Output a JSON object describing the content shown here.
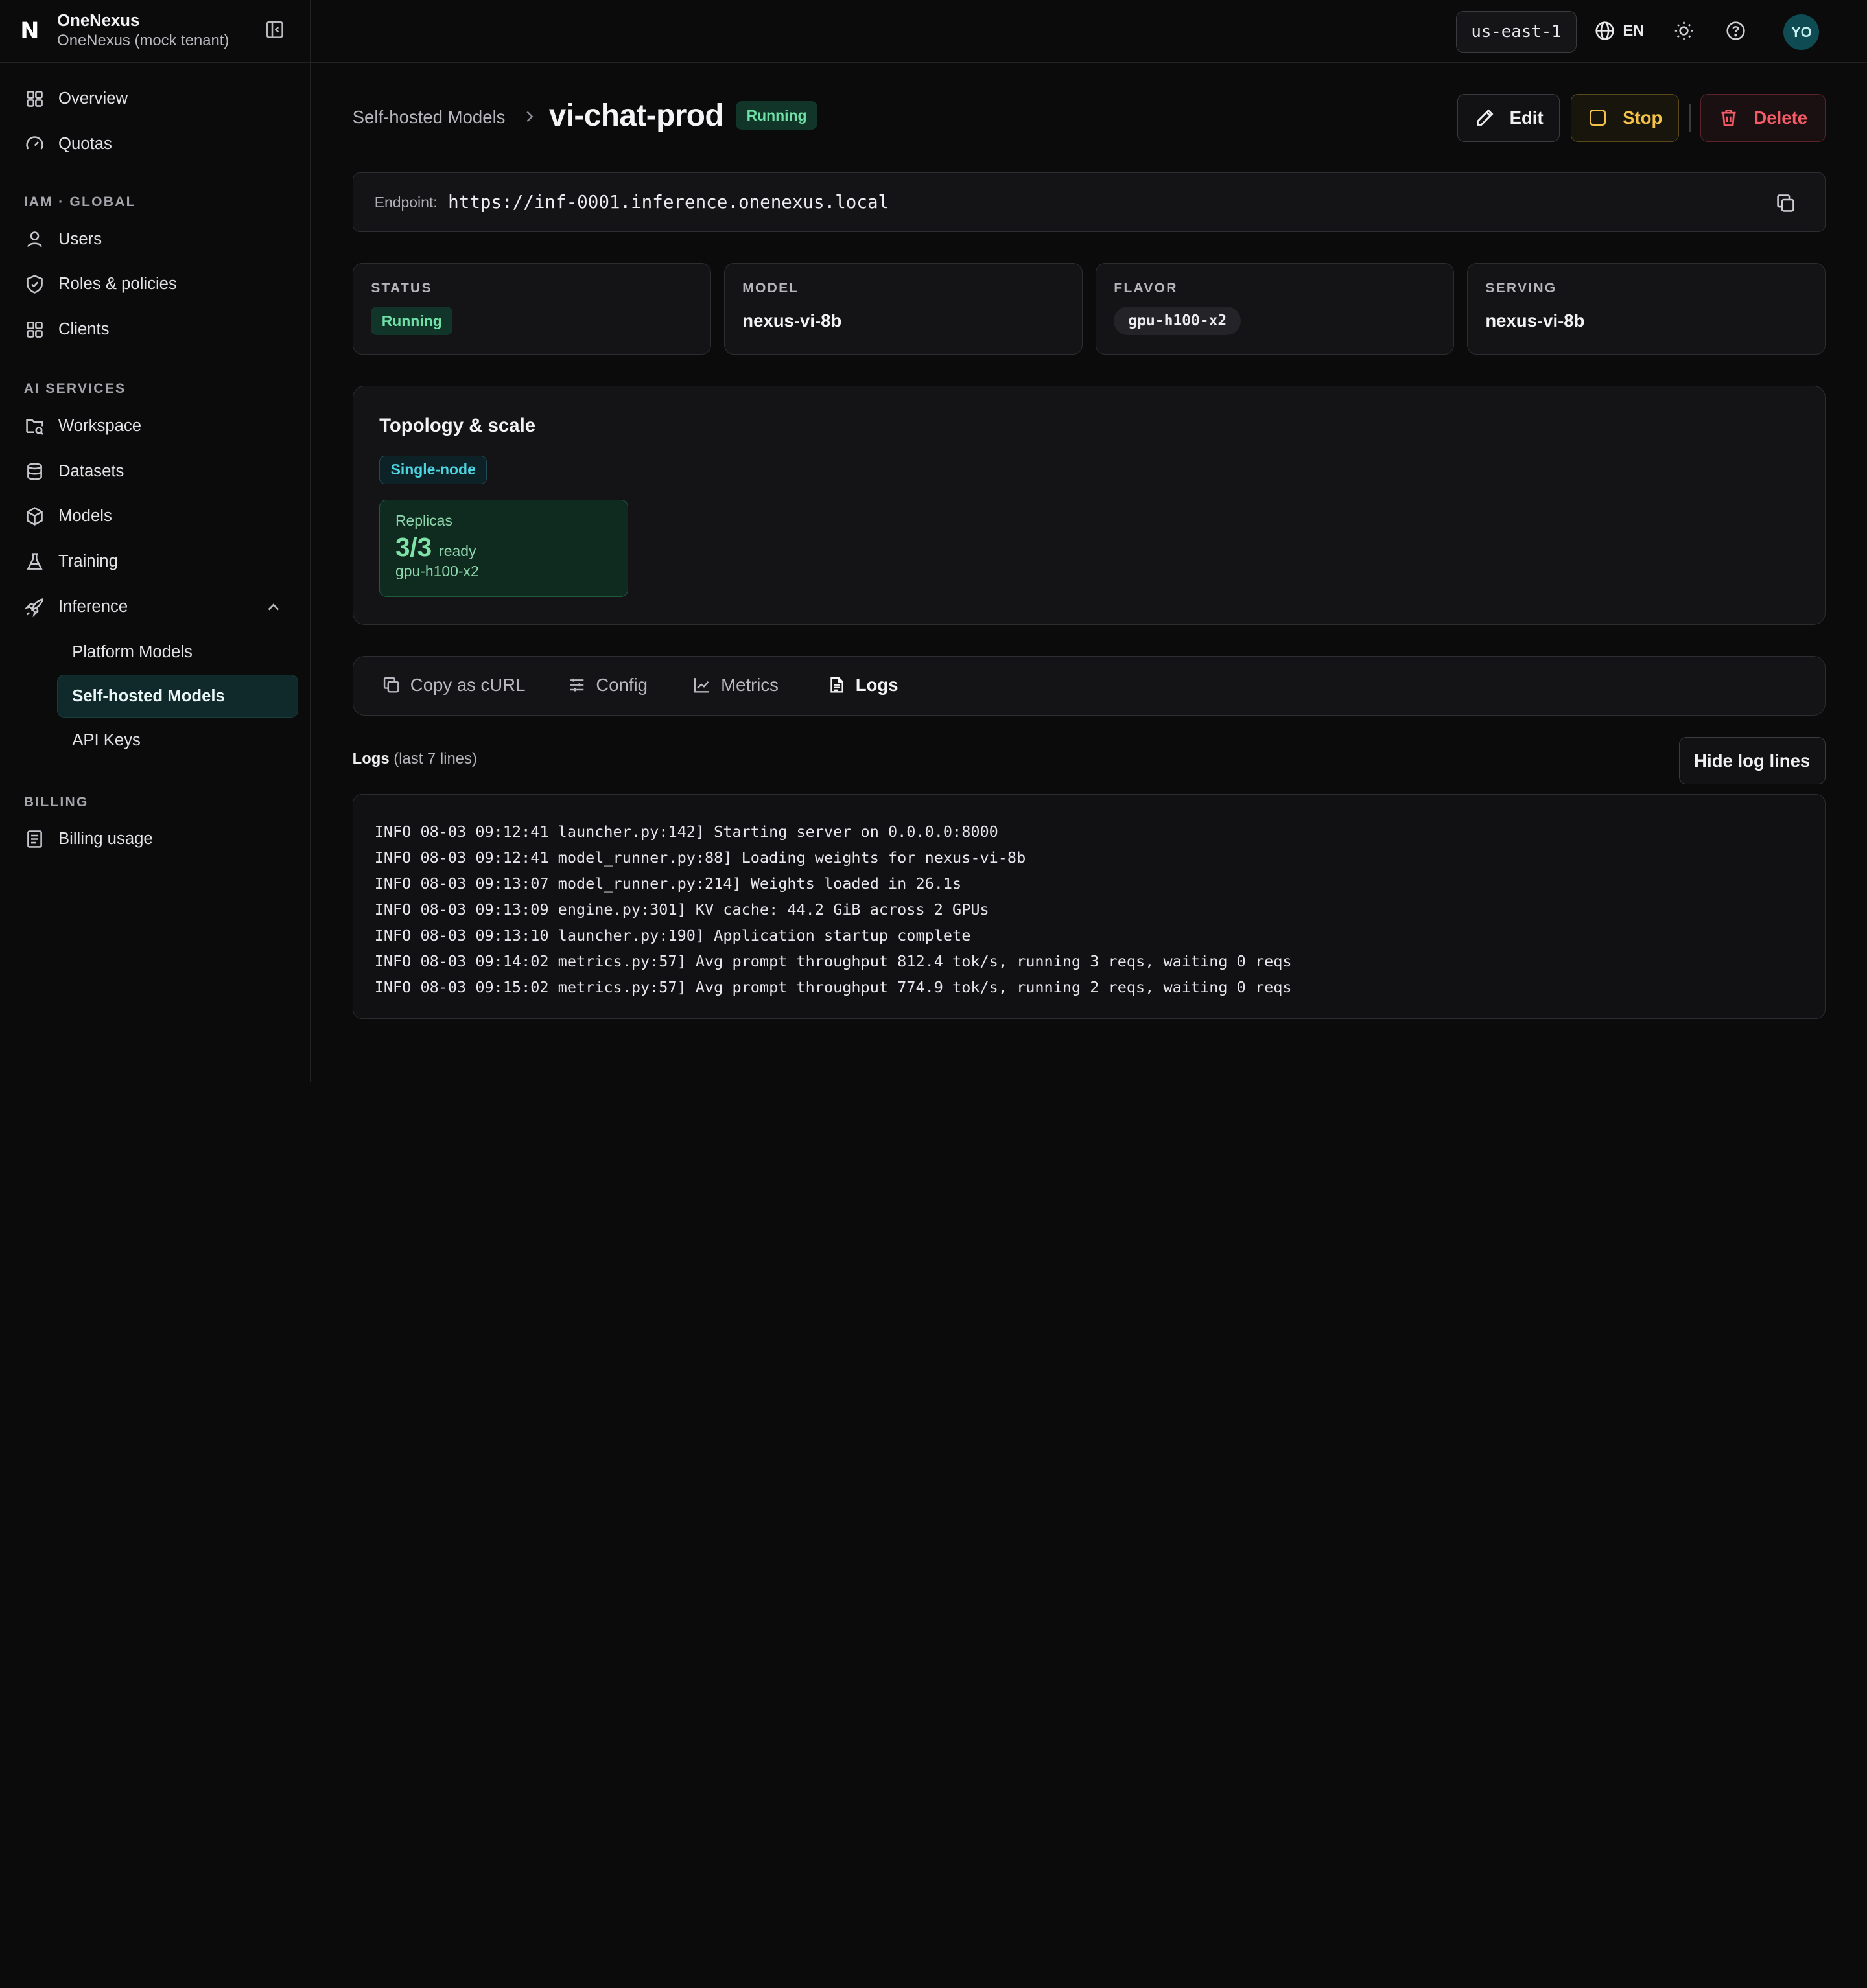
{
  "brand": {
    "name": "OneNexus",
    "tenant": "OneNexus (mock tenant)",
    "logo": "N"
  },
  "sidebar": {
    "top_items": [
      {
        "label": "Overview",
        "icon": "grid-icon"
      },
      {
        "label": "Quotas",
        "icon": "gauge-icon"
      }
    ],
    "sections": [
      {
        "title": "IAM · GLOBAL",
        "items": [
          "Users",
          "Roles & policies",
          "Clients"
        ]
      },
      {
        "title": "AI SERVICES",
        "items": [
          "Workspace",
          "Datasets",
          "Models",
          "Training",
          "Inference"
        ]
      },
      {
        "title": "BILLING",
        "items": [
          "Billing usage"
        ]
      }
    ],
    "inference_sub": [
      "Platform Models",
      "Self-hosted Models",
      "API Keys"
    ],
    "active_sub": "Self-hosted Models"
  },
  "topbar": {
    "region": "us-east-1",
    "lang": "EN",
    "avatar": "YO"
  },
  "header": {
    "breadcrumb": "Self-hosted Models",
    "title": "vi-chat-prod",
    "status": "Running",
    "edit": "Edit",
    "stop": "Stop",
    "delete": "Delete"
  },
  "endpoint": {
    "label": "Endpoint:",
    "url": "https://inf-0001.inference.onenexus.local"
  },
  "stats": {
    "status": {
      "label": "STATUS",
      "value": "Running"
    },
    "model": {
      "label": "MODEL",
      "value": "nexus-vi-8b"
    },
    "flavor": {
      "label": "FLAVOR",
      "value": "gpu-h100-x2"
    },
    "serving": {
      "label": "SERVING",
      "value": "nexus-vi-8b"
    }
  },
  "topology": {
    "title": "Topology & scale",
    "mode": "Single-node",
    "replicas_label": "Replicas",
    "replicas_value": "3/3",
    "replicas_ready": "ready",
    "replicas_flavor": "gpu-h100-x2"
  },
  "tabs": [
    "Copy as cURL",
    "Config",
    "Metrics",
    "Logs"
  ],
  "active_tab": "Logs",
  "logs": {
    "title": "Logs",
    "subtitle": "(last 7 lines)",
    "hide_button": "Hide log lines",
    "lines": [
      "INFO 08-03 09:12:41 launcher.py:142] Starting server on 0.0.0.0:8000",
      "INFO 08-03 09:12:41 model_runner.py:88] Loading weights for nexus-vi-8b",
      "INFO 08-03 09:13:07 model_runner.py:214] Weights loaded in 26.1s",
      "INFO 08-03 09:13:09 engine.py:301] KV cache: 44.2 GiB across 2 GPUs",
      "INFO 08-03 09:13:10 launcher.py:190] Application startup complete",
      "INFO 08-03 09:14:02 metrics.py:57] Avg prompt throughput 812.4 tok/s, running 3 reqs, waiting 0 reqs",
      "INFO 08-03 09:15:02 metrics.py:57] Avg prompt throughput 774.9 tok/s, running 2 reqs, waiting 0 reqs"
    ]
  },
  "colors": {
    "accent": "#10292b",
    "running": "#6fe0a6",
    "stop": "#f4c347",
    "delete": "#f35b66",
    "cyan": "#4dd2e0"
  }
}
